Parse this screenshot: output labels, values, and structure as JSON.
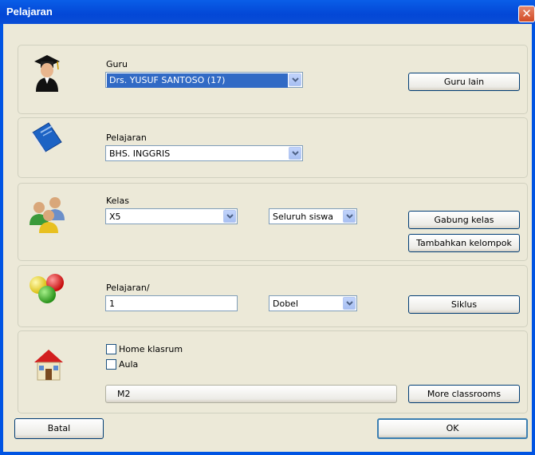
{
  "window": {
    "title": "Pelajaran"
  },
  "guru": {
    "label": "Guru",
    "value": "Drs. YUSUF SANTOSO (17)",
    "button": "Guru lain"
  },
  "pelajaran": {
    "label": "Pelajaran",
    "value": "BHS. INGGRIS"
  },
  "kelas": {
    "label": "Kelas",
    "value": "X5",
    "group": "Seluruh siswa",
    "join_button": "Gabung kelas",
    "add_group_button": "Tambahkan kelompok"
  },
  "lessons": {
    "label": "Pelajaran/",
    "count": "1",
    "type": "Dobel",
    "cycle_button": "Siklus"
  },
  "room": {
    "home_label": "Home klasrum",
    "home_checked": false,
    "aula_label": "Aula",
    "aula_checked": false,
    "room_value": "M2",
    "more_button": "More classrooms"
  },
  "footer": {
    "cancel": "Batal",
    "ok": "OK"
  },
  "icons": {
    "close": "close-icon",
    "teacher": "teacher-graduate-icon",
    "book": "book-icon",
    "students": "students-group-icon",
    "balls": "colored-balls-icon",
    "house": "house-icon"
  }
}
